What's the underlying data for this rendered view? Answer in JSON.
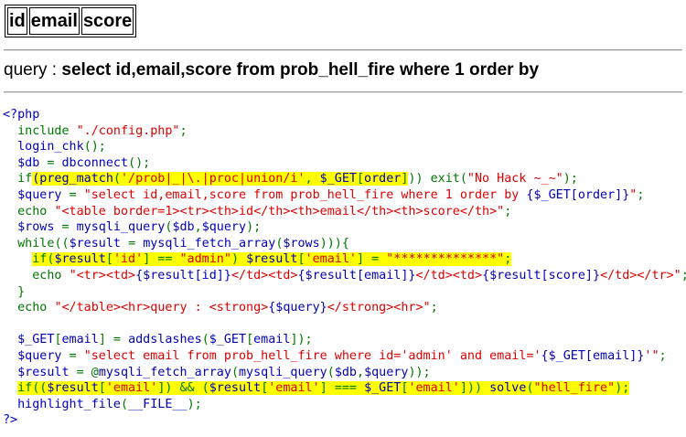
{
  "table": {
    "headers": [
      "id",
      "email",
      "score"
    ]
  },
  "query": {
    "label": "query : ",
    "sql": "select id,email,score from prob_hell_fire where 1 order by"
  },
  "code": {
    "lines": [
      [
        {
          "t": "<?php",
          "c": "d"
        }
      ],
      [
        {
          "t": "  include ",
          "c": "k"
        },
        {
          "t": "\"./config.php\"",
          "c": "s"
        },
        {
          "t": ";",
          "c": "k"
        }
      ],
      [
        {
          "t": "  login_chk",
          "c": "d"
        },
        {
          "t": "();",
          "c": "k"
        }
      ],
      [
        {
          "t": "  $db ",
          "c": "d"
        },
        {
          "t": "= ",
          "c": "k"
        },
        {
          "t": "dbconnect",
          "c": "d"
        },
        {
          "t": "();",
          "c": "k"
        }
      ],
      [
        {
          "t": "  if",
          "c": "k"
        },
        {
          "t": "(preg_match",
          "c": "d",
          "h": true
        },
        {
          "t": "(",
          "c": "k",
          "h": true
        },
        {
          "t": "'/prob|_|\\.|proc|union/i'",
          "c": "s",
          "h": true
        },
        {
          "t": ", ",
          "c": "k",
          "h": true
        },
        {
          "t": "$_GET",
          "c": "d",
          "h": true
        },
        {
          "t": "[",
          "c": "k",
          "h": true
        },
        {
          "t": "order",
          "c": "d",
          "h": true
        },
        {
          "t": "]",
          "c": "k",
          "h": true
        },
        {
          "t": ")) exit(",
          "c": "k"
        },
        {
          "t": "\"No Hack ~_~\"",
          "c": "s"
        },
        {
          "t": ");",
          "c": "k"
        }
      ],
      [
        {
          "t": "  $query ",
          "c": "d"
        },
        {
          "t": "= ",
          "c": "k"
        },
        {
          "t": "\"select id,email,score from prob_hell_fire where 1 order by ",
          "c": "s"
        },
        {
          "t": "{$_GET[order]}",
          "c": "d"
        },
        {
          "t": "\"",
          "c": "s"
        },
        {
          "t": ";",
          "c": "k"
        }
      ],
      [
        {
          "t": "  echo ",
          "c": "k"
        },
        {
          "t": "\"<table border=1><tr><th>id</th><th>email</th><th>score</th>\"",
          "c": "s"
        },
        {
          "t": ";",
          "c": "k"
        }
      ],
      [
        {
          "t": "  $rows ",
          "c": "d"
        },
        {
          "t": "= ",
          "c": "k"
        },
        {
          "t": "mysqli_query",
          "c": "d"
        },
        {
          "t": "(",
          "c": "k"
        },
        {
          "t": "$db",
          "c": "d"
        },
        {
          "t": ",",
          "c": "k"
        },
        {
          "t": "$query",
          "c": "d"
        },
        {
          "t": ");",
          "c": "k"
        }
      ],
      [
        {
          "t": "  while",
          "c": "k"
        },
        {
          "t": "((",
          "c": "k"
        },
        {
          "t": "$result ",
          "c": "d"
        },
        {
          "t": "= ",
          "c": "k"
        },
        {
          "t": "mysqli_fetch_array",
          "c": "d"
        },
        {
          "t": "(",
          "c": "k"
        },
        {
          "t": "$rows",
          "c": "d"
        },
        {
          "t": "))){",
          "c": "k"
        }
      ],
      [
        {
          "t": "    ",
          "c": "k"
        },
        {
          "t": "if(",
          "c": "k",
          "h": true
        },
        {
          "t": "$result",
          "c": "d",
          "h": true
        },
        {
          "t": "[",
          "c": "k",
          "h": true
        },
        {
          "t": "'id'",
          "c": "s",
          "h": true
        },
        {
          "t": "] == ",
          "c": "k",
          "h": true
        },
        {
          "t": "\"admin\"",
          "c": "s",
          "h": true
        },
        {
          "t": ") ",
          "c": "k",
          "h": true
        },
        {
          "t": "$result",
          "c": "d",
          "h": true
        },
        {
          "t": "[",
          "c": "k",
          "h": true
        },
        {
          "t": "'email'",
          "c": "s",
          "h": true
        },
        {
          "t": "] = ",
          "c": "k",
          "h": true
        },
        {
          "t": "\"**************\"",
          "c": "s",
          "h": true
        },
        {
          "t": ";",
          "c": "k",
          "h": true
        }
      ],
      [
        {
          "t": "    echo ",
          "c": "k"
        },
        {
          "t": "\"<tr><td>",
          "c": "s"
        },
        {
          "t": "{$result[id]}",
          "c": "d"
        },
        {
          "t": "</td><td>",
          "c": "s"
        },
        {
          "t": "{$result[email]}",
          "c": "d"
        },
        {
          "t": "</td><td>",
          "c": "s"
        },
        {
          "t": "{$result[score]}",
          "c": "d"
        },
        {
          "t": "</td></tr>\"",
          "c": "s"
        },
        {
          "t": ";",
          "c": "k"
        }
      ],
      [
        {
          "t": "  }",
          "c": "k"
        }
      ],
      [
        {
          "t": "  echo ",
          "c": "k"
        },
        {
          "t": "\"</table><hr>query : <strong>",
          "c": "s"
        },
        {
          "t": "{$query}",
          "c": "d"
        },
        {
          "t": "</strong><hr>\"",
          "c": "s"
        },
        {
          "t": ";",
          "c": "k"
        }
      ],
      [
        {
          "t": "",
          "c": "k"
        }
      ],
      [
        {
          "t": "  $_GET",
          "c": "d"
        },
        {
          "t": "[",
          "c": "k"
        },
        {
          "t": "email",
          "c": "d"
        },
        {
          "t": "] = ",
          "c": "k"
        },
        {
          "t": "addslashes",
          "c": "d"
        },
        {
          "t": "(",
          "c": "k"
        },
        {
          "t": "$_GET",
          "c": "d"
        },
        {
          "t": "[",
          "c": "k"
        },
        {
          "t": "email",
          "c": "d"
        },
        {
          "t": "]);",
          "c": "k"
        }
      ],
      [
        {
          "t": "  $query ",
          "c": "d"
        },
        {
          "t": "= ",
          "c": "k"
        },
        {
          "t": "\"select email from prob_hell_fire where id='admin' and email='",
          "c": "s"
        },
        {
          "t": "{$_GET[email]}",
          "c": "d"
        },
        {
          "t": "'\"",
          "c": "s"
        },
        {
          "t": ";",
          "c": "k"
        }
      ],
      [
        {
          "t": "  $result ",
          "c": "d"
        },
        {
          "t": "= @",
          "c": "k"
        },
        {
          "t": "mysqli_fetch_array",
          "c": "d"
        },
        {
          "t": "(",
          "c": "k"
        },
        {
          "t": "mysqli_query",
          "c": "d"
        },
        {
          "t": "(",
          "c": "k"
        },
        {
          "t": "$db",
          "c": "d"
        },
        {
          "t": ",",
          "c": "k"
        },
        {
          "t": "$query",
          "c": "d"
        },
        {
          "t": "));",
          "c": "k"
        }
      ],
      [
        {
          "t": "  ",
          "c": "k"
        },
        {
          "t": "if((",
          "c": "k",
          "h": true
        },
        {
          "t": "$result",
          "c": "d",
          "h": true
        },
        {
          "t": "[",
          "c": "k",
          "h": true
        },
        {
          "t": "'email'",
          "c": "s",
          "h": true
        },
        {
          "t": "]) && (",
          "c": "k",
          "h": true
        },
        {
          "t": "$result",
          "c": "d",
          "h": true
        },
        {
          "t": "[",
          "c": "k",
          "h": true
        },
        {
          "t": "'email'",
          "c": "s",
          "h": true
        },
        {
          "t": "] === ",
          "c": "k",
          "h": true
        },
        {
          "t": "$_GET",
          "c": "d",
          "h": true
        },
        {
          "t": "[",
          "c": "k",
          "h": true
        },
        {
          "t": "'email'",
          "c": "s",
          "h": true
        },
        {
          "t": "])) ",
          "c": "k",
          "h": true
        },
        {
          "t": "solve",
          "c": "d",
          "h": true
        },
        {
          "t": "(",
          "c": "k",
          "h": true
        },
        {
          "t": "\"hell_fire\"",
          "c": "s",
          "h": true
        },
        {
          "t": ");",
          "c": "k",
          "h": true
        }
      ],
      [
        {
          "t": "  highlight_file",
          "c": "d"
        },
        {
          "t": "(",
          "c": "k"
        },
        {
          "t": "__FILE__",
          "c": "d"
        },
        {
          "t": ");",
          "c": "k"
        }
      ],
      [
        {
          "t": "?>",
          "c": "d"
        }
      ]
    ]
  },
  "colors": {
    "default": "#0000bb",
    "keyword": "#007700",
    "string": "#dd0000",
    "highlight": "#ffff00"
  }
}
